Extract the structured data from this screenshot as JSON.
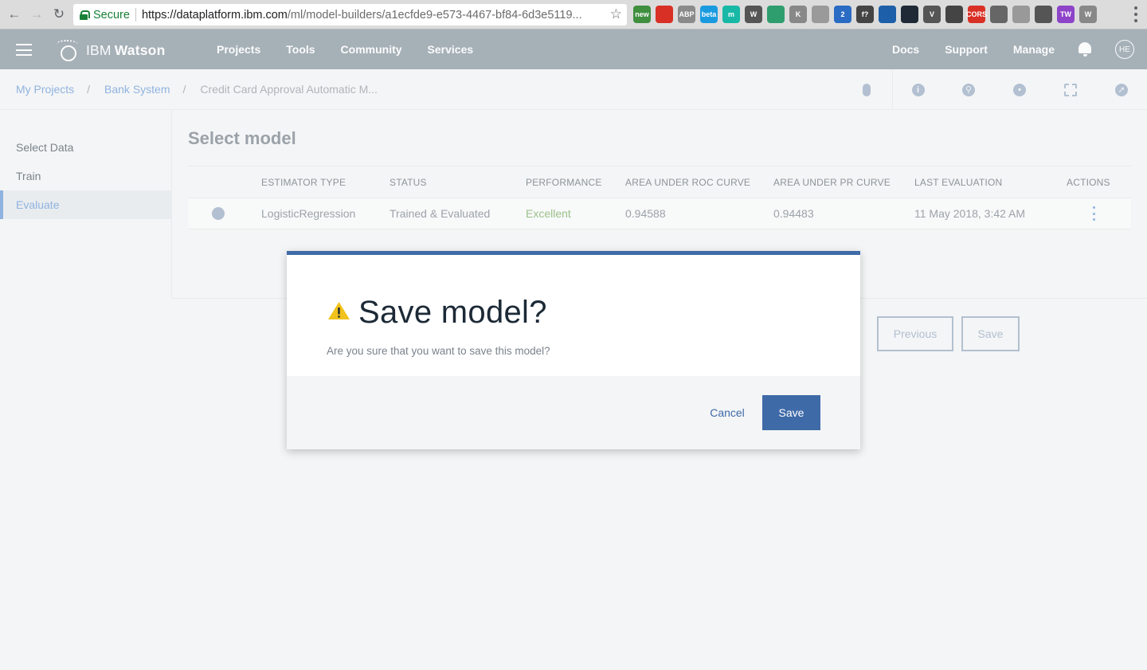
{
  "browser": {
    "secure_label": "Secure",
    "url_host": "https://dataplatform.ibm.com",
    "url_path": "/ml/model-builders/a1ecfde9-e573-4467-bf84-6d3e5119...",
    "extensions": [
      {
        "name": "new-ext-icon",
        "label": "new",
        "color": "#3f8f3f"
      },
      {
        "name": "opera-ext-icon",
        "label": "",
        "color": "#d93025"
      },
      {
        "name": "abp-ext-icon",
        "label": "ABP",
        "color": "#8a8a8a"
      },
      {
        "name": "beta-ext-icon",
        "label": "beta",
        "color": "#1a9be0"
      },
      {
        "name": "m-ext-icon",
        "label": "m",
        "color": "#17b8a6"
      },
      {
        "name": "wordpress-ext-icon",
        "label": "W",
        "color": "#555555"
      },
      {
        "name": "key-ext-icon",
        "label": "",
        "color": "#2f9e6e"
      },
      {
        "name": "k-ext-icon",
        "label": "K",
        "color": "#888888"
      },
      {
        "name": "circle-ext-icon",
        "label": "",
        "color": "#9a9a9a"
      },
      {
        "name": "puzzle-ext-icon",
        "label": "2",
        "color": "#2a6cc4"
      },
      {
        "name": "f-ext-icon",
        "label": "f?",
        "color": "#444444"
      },
      {
        "name": "pencil-ext-icon",
        "label": "",
        "color": "#1d5fa8"
      },
      {
        "name": "react-ext-icon",
        "label": "",
        "color": "#1f2a36"
      },
      {
        "name": "v-ext-icon",
        "label": "V",
        "color": "#555555"
      },
      {
        "name": "target-ext-icon",
        "label": "",
        "color": "#444444"
      },
      {
        "name": "cors-ext-icon",
        "label": "CORS",
        "color": "#d93025"
      },
      {
        "name": "hat-ext-icon",
        "label": "",
        "color": "#666666"
      },
      {
        "name": "square-ext-icon",
        "label": "",
        "color": "#999999"
      },
      {
        "name": "monitor-ext-icon",
        "label": "",
        "color": "#555555"
      },
      {
        "name": "tw-ext-icon",
        "label": "TW",
        "color": "#8e44c9"
      },
      {
        "name": "w-ext-icon",
        "label": "W",
        "color": "#888888"
      }
    ]
  },
  "header": {
    "brand_ibm": "IBM",
    "brand_watson": "Watson",
    "nav": [
      "Projects",
      "Tools",
      "Community",
      "Services"
    ],
    "right_nav": [
      "Docs",
      "Support",
      "Manage"
    ],
    "avatar_initials": "HE"
  },
  "breadcrumb": {
    "items": [
      "My Projects",
      "Bank System"
    ],
    "separator": "/",
    "current": "Credit Card Approval Automatic M..."
  },
  "toolbar": {
    "icons": [
      "lock-icon",
      "info-icon",
      "find-icon",
      "chat-icon",
      "grid-icon",
      "compass-icon"
    ]
  },
  "sidebar": {
    "items": [
      "Select Data",
      "Train",
      "Evaluate"
    ],
    "active": "Evaluate"
  },
  "main": {
    "title": "Select model",
    "columns": [
      "ESTIMATOR TYPE",
      "STATUS",
      "PERFORMANCE",
      "AREA UNDER ROC CURVE",
      "AREA UNDER PR CURVE",
      "LAST EVALUATION",
      "ACTIONS"
    ],
    "rows": [
      {
        "estimator": "LogisticRegression",
        "status": "Trained & Evaluated",
        "performance": "Excellent",
        "roc": "0.94588",
        "pr": "0.94483",
        "last_evaluation": "11 May 2018, 3:42 AM"
      }
    ],
    "previous_label": "Previous",
    "save_label": "Save"
  },
  "modal": {
    "title": "Save model?",
    "message": "Are you sure that you want to save this model?",
    "cancel_label": "Cancel",
    "save_label": "Save",
    "accent_color": "#3f6aa8",
    "warning_color": "#f1c21b"
  }
}
